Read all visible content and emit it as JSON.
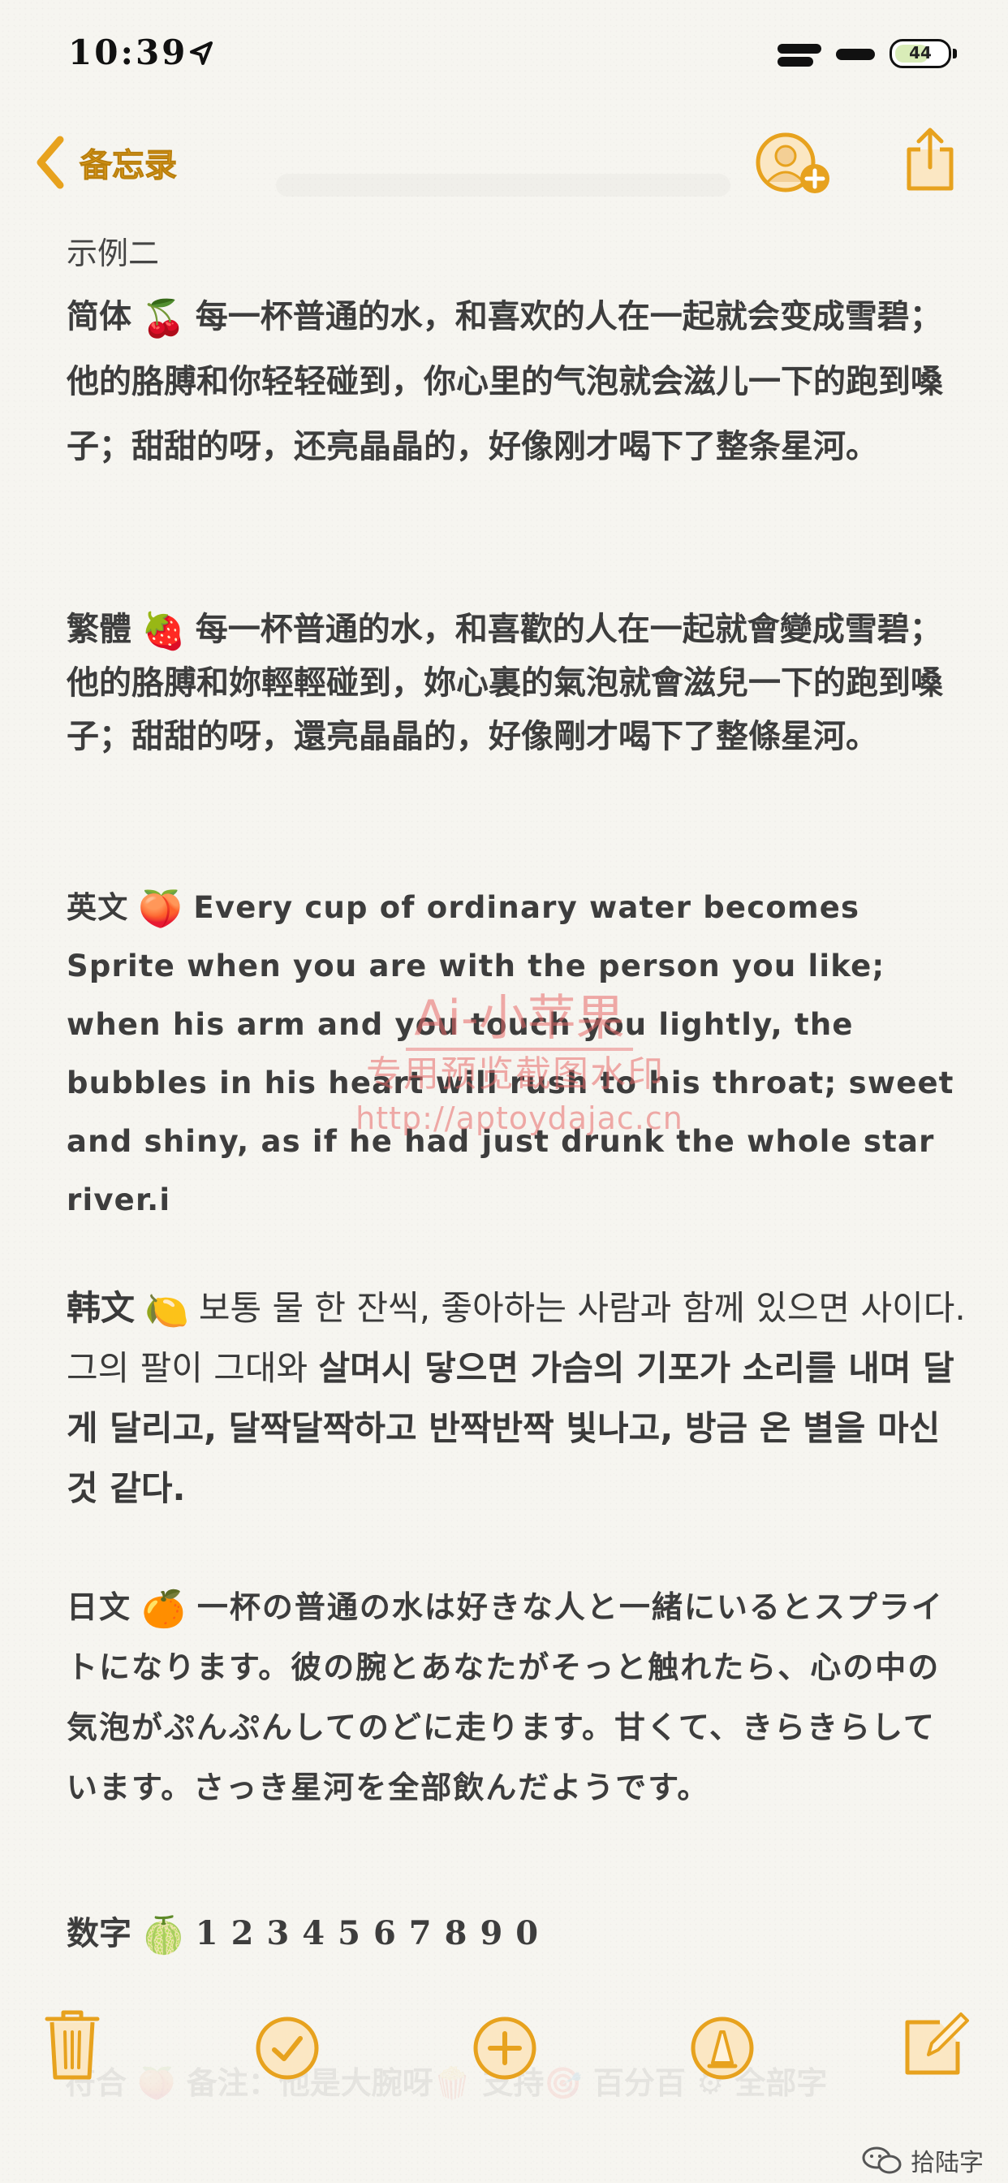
{
  "status_bar": {
    "time": "10:39",
    "battery_level": "44"
  },
  "nav": {
    "back_label": "备忘录"
  },
  "note": {
    "title": "示例二",
    "simplified": {
      "label": "简体",
      "emoji": "🍒",
      "text": "每一杯普通的水，和喜欢的人在一起就会变成雪碧；他的胳膊和你轻轻碰到，你心里的气泡就会滋儿一下的跑到嗓子；甜甜的呀，还亮晶晶的，好像刚才喝下了整条星河。"
    },
    "traditional": {
      "label": "繁體",
      "emoji": "🍓",
      "text": "每一杯普通的水，和喜歡的人在一起就會變成雪碧；他的胳膊和妳輕輕碰到，妳心裏的氣泡就會滋兒一下的跑到嗓子；甜甜的呀，還亮晶晶的，好像剛才喝下了整條星河。"
    },
    "english": {
      "label": "英文",
      "emoji": "🍑",
      "text": "Every cup of ordinary water becomes Sprite when you are with the person you like; when his arm and you touch you lightly, the bubbles in his heart will rush to his throat; sweet and shiny, as if he had just drunk the whole star river.i"
    },
    "korean": {
      "label": "韩文",
      "emoji": "🍋",
      "text_regular": "보통 물 한 잔씩, 좋아하는 사람과 함께 있으면 사이다. 그의 팔이 그대와 ",
      "text_bold": "살며시 닿으면 가슴의 기포가 소리를 내며 달게 달리고, 달짝달짝하고 반짝반짝 빛나고, 방금 온 별을 마신 것 같다."
    },
    "japanese": {
      "label": "日文",
      "emoji": "🍊",
      "text": "一杯の普通の水は好きな人と一緒にいるとスプライトになります。彼の腕とあなたがそっと触れたら、心の中の気泡がぷんぷんしてのどに走ります。甘くて、きらきらしています。さっき星河を全部飲んだようです。"
    },
    "digits": {
      "label": "数字",
      "emoji": "🍈",
      "text": "1234567890"
    }
  },
  "watermark": {
    "title": "Ai-小苹果",
    "subtitle": "专用预览截图水印",
    "url": "http://aptoydajac.cn"
  },
  "ghost_line": "符合 🍑 备注：他是大腕呀🍿 支持🎯 百分百 ⚙ 全部字",
  "toolbar": {
    "icons": [
      "trash-icon",
      "checklist-icon",
      "add-icon",
      "markup-icon",
      "compose-icon"
    ]
  },
  "credit": {
    "text": "拾陆字"
  },
  "colors": {
    "accent": "#e7a21e",
    "watermark": "#e86868",
    "background": "#f6f5f0"
  }
}
